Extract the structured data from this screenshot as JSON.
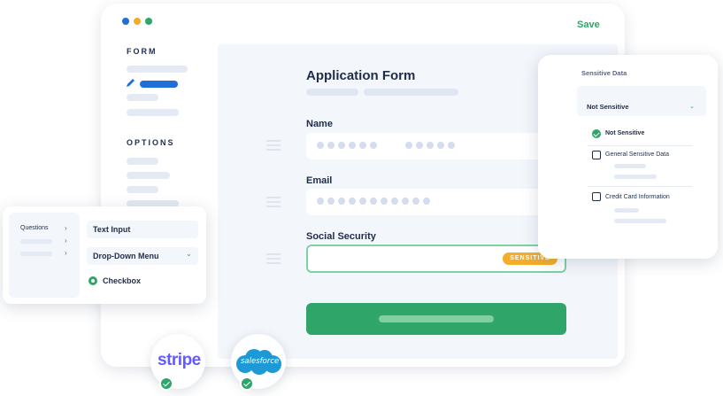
{
  "window": {
    "traffic_colors": [
      "#1f6fd6",
      "#f4ad2b",
      "#2fa56a"
    ],
    "save_label": "Save"
  },
  "sidebar": {
    "form_heading": "FORM",
    "options_heading": "OPTIONS"
  },
  "form": {
    "title": "Application Form",
    "fields": [
      {
        "label": "Name",
        "value_masked": true
      },
      {
        "label": "Email",
        "value_masked": true
      },
      {
        "label": "Social Security",
        "badge": "SENSITIVE"
      }
    ]
  },
  "sensitive_panel": {
    "title": "Sensitive Data",
    "selected": "Not Sensitive",
    "options": [
      {
        "label": "Not Sensitive",
        "checked": true
      },
      {
        "label": "General Sensitive Data",
        "checked": false
      },
      {
        "label": "Credit Card Information",
        "checked": false
      }
    ]
  },
  "builder": {
    "questions_label": "Questions",
    "items": [
      "Text Input",
      "Drop-Down Menu",
      "Checkbox"
    ]
  },
  "integrations": {
    "stripe": "stripe",
    "salesforce": "salesforce"
  },
  "colors": {
    "accent_green": "#2fa56a",
    "accent_blue": "#1f6fd6",
    "badge_orange": "#f4ad2b"
  }
}
